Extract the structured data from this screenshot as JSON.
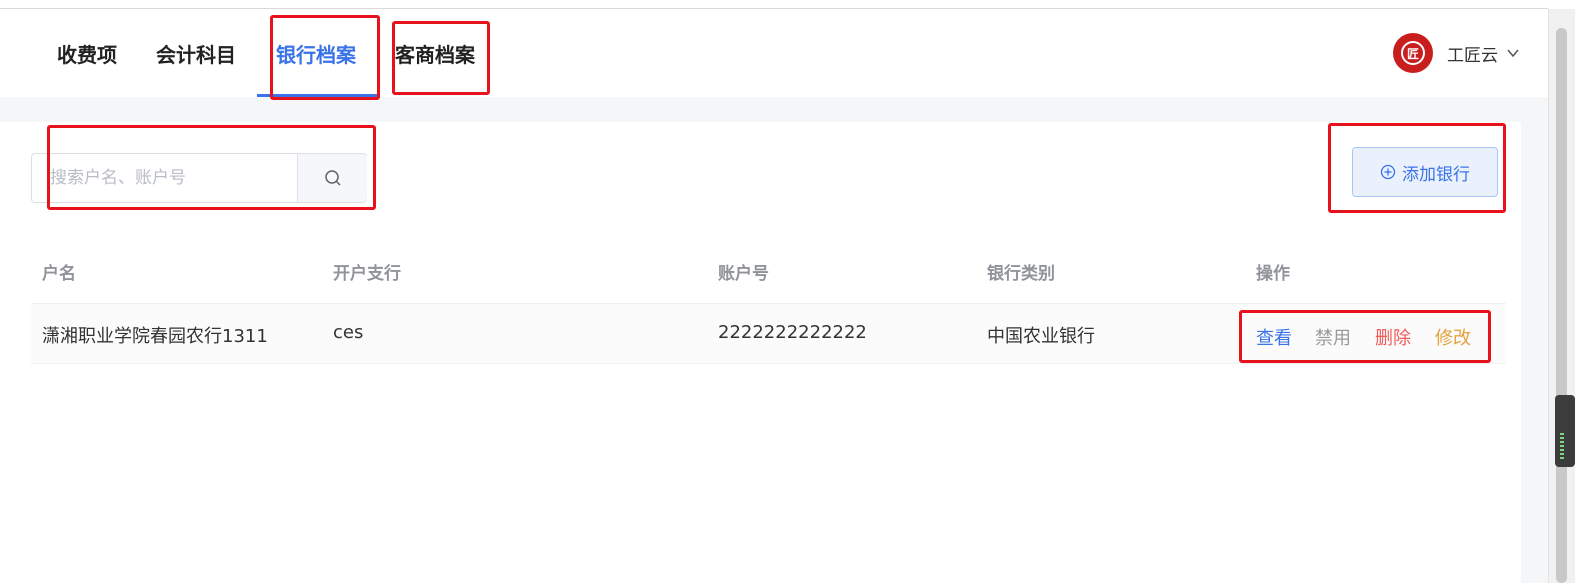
{
  "tabs": [
    {
      "label": "收费项"
    },
    {
      "label": "会计科目"
    },
    {
      "label": "银行档案"
    },
    {
      "label": "客商档案"
    }
  ],
  "user": {
    "name": "工匠云",
    "avatar_glyph": "匠",
    "avatar_color": "#c81e1e"
  },
  "search": {
    "placeholder": "搜索户名、账户号",
    "value": ""
  },
  "add_button": {
    "label": "添加银行",
    "icon": "plus-circle-icon"
  },
  "table": {
    "headers": [
      "户名",
      "开户支行",
      "账户号",
      "银行类别",
      "操作"
    ],
    "rows": [
      {
        "account_name": "潇湘职业学院春园农行1311",
        "branch": "ces",
        "account_no": "2222222222222",
        "bank_type": "中国农业银行",
        "actions": {
          "view": "查看",
          "disable": "禁用",
          "delete": "删除",
          "edit": "修改"
        }
      }
    ]
  },
  "colors": {
    "accent": "#3a73e8",
    "view": "#3a73e8",
    "disable": "#999999",
    "delete": "#f25a5a",
    "edit": "#e6a23c",
    "highlight": "#e8121c"
  }
}
